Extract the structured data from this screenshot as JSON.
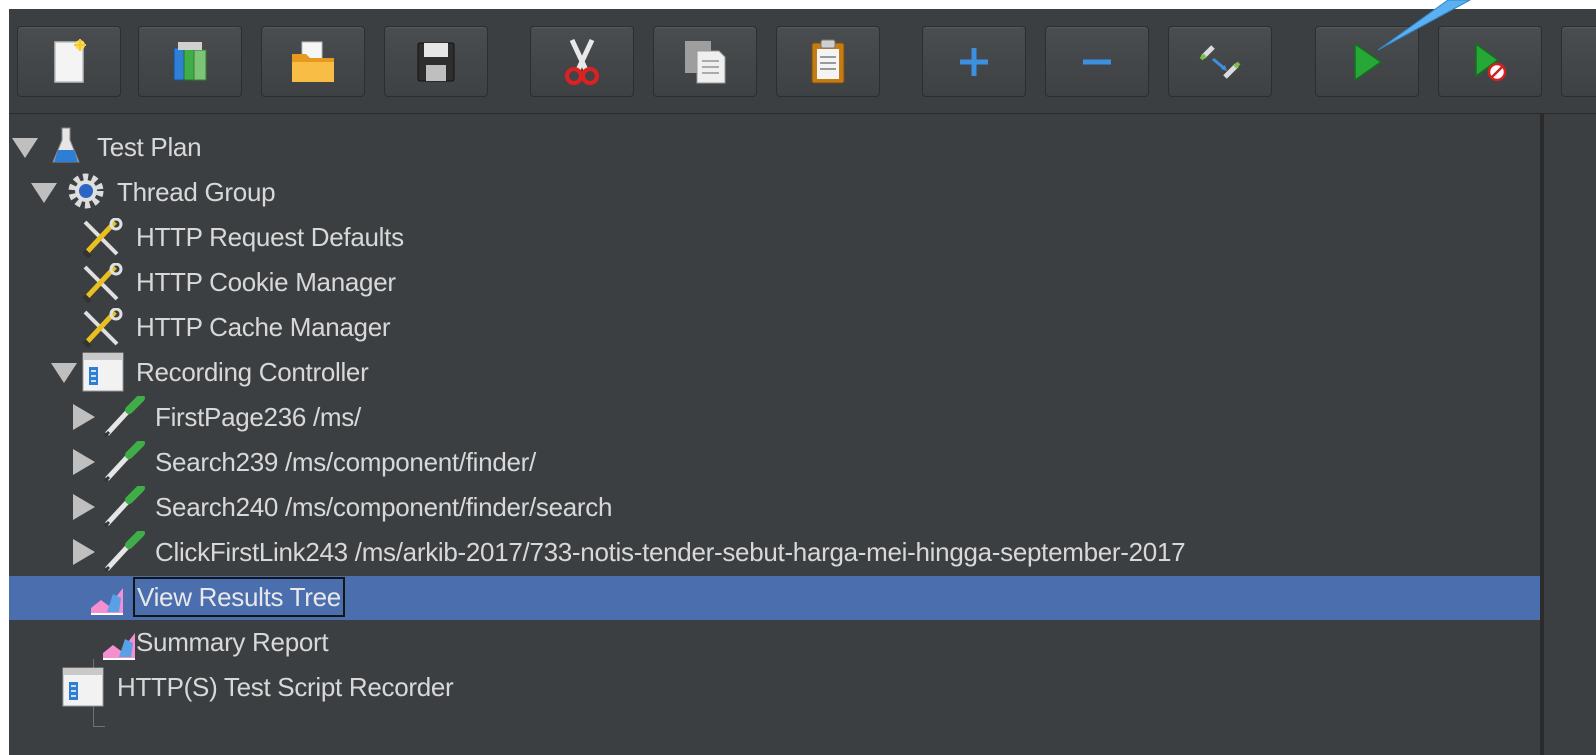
{
  "toolbar": {
    "buttons": [
      {
        "name": "new-icon",
        "label": "New"
      },
      {
        "name": "templates-icon",
        "label": "Templates"
      },
      {
        "name": "open-icon",
        "label": "Open"
      },
      {
        "name": "save-icon",
        "label": "Save"
      },
      {
        "name": "cut-icon",
        "label": "Cut"
      },
      {
        "name": "copy-icon",
        "label": "Copy"
      },
      {
        "name": "paste-icon",
        "label": "Paste"
      },
      {
        "name": "expand-all-icon",
        "label": "Expand All"
      },
      {
        "name": "collapse-all-icon",
        "label": "Collapse All"
      },
      {
        "name": "toggle-icon",
        "label": "Toggle"
      },
      {
        "name": "start-icon",
        "label": "Start"
      },
      {
        "name": "start-no-pauses-icon",
        "label": "Start no pauses"
      }
    ]
  },
  "tree": {
    "test_plan": "Test Plan",
    "thread_group": "Thread Group",
    "http_request_defaults": "HTTP Request Defaults",
    "http_cookie_manager": "HTTP Cookie Manager",
    "http_cache_manager": "HTTP Cache Manager",
    "recording_controller": "Recording Controller",
    "sampler_1": "FirstPage236 /ms/",
    "sampler_2": "Search239 /ms/component/finder/",
    "sampler_3": "Search240 /ms/component/finder/search",
    "sampler_4": "ClickFirstLink243 /ms/arkib-2017/733-notis-tender-sebut-harga-mei-hingga-september-2017",
    "view_results_tree": "View Results Tree",
    "summary_report": "Summary Report",
    "test_script_recorder": "HTTP(S) Test Script Recorder"
  },
  "colors": {
    "background": "#3c3f41",
    "selection": "#4b6eaf",
    "text": "#d8d8d8",
    "callout": "#5ab0f0"
  }
}
